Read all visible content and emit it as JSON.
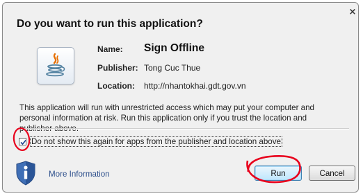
{
  "dialog": {
    "title": "Do you want to run this application?",
    "close_glyph": "×"
  },
  "app": {
    "icon": "java-icon",
    "name_label": "Name:",
    "name_value": "Sign Offline",
    "publisher_label": "Publisher:",
    "publisher_value": "Tong Cuc Thue",
    "location_label": "Location:",
    "location_value": "http://nhantokhai.gdt.gov.vn"
  },
  "warning_text": "This application will run with unrestricted access which may put your computer and personal information at risk. Run this application only if you trust the location and publisher above.",
  "checkbox": {
    "label": "Do not show this again for apps from the publisher and location above",
    "checked": true
  },
  "footer": {
    "info_icon": "shield-info-icon",
    "more_info_label": "More Information",
    "run_label": "Run",
    "cancel_label": "Cancel"
  },
  "annotations": {
    "color": "#e8001c"
  }
}
